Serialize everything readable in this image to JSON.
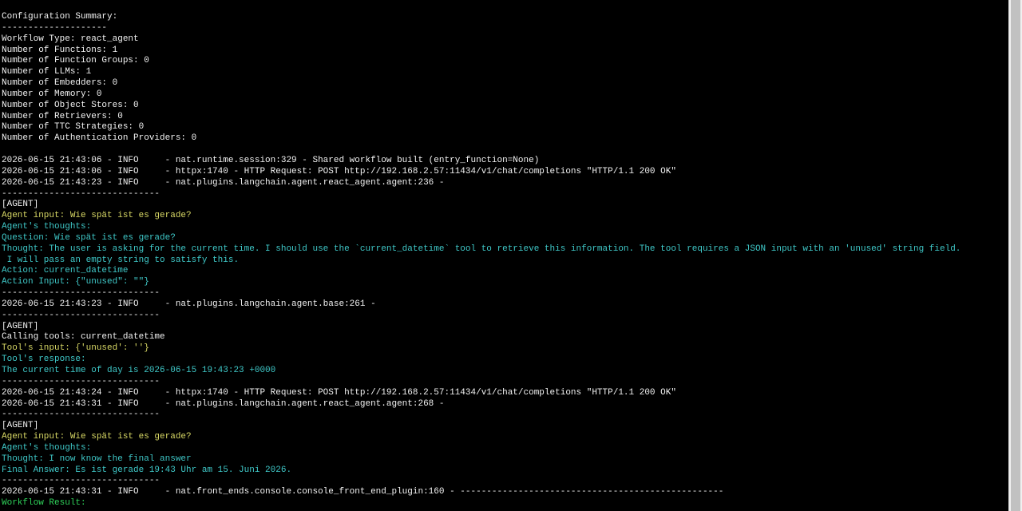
{
  "colors": {
    "background": "#000000",
    "text": "#f2f2f2",
    "agent_input": "#d7d765",
    "agent_thoughts": "#3fc8c8",
    "workflow_result": "#2fd25a",
    "scrollbar": "#f0f0f0"
  },
  "lines": [
    {
      "text": "Configuration Summary:",
      "color": "white"
    },
    {
      "text": "--------------------",
      "color": "white"
    },
    {
      "text": "Workflow Type: react_agent",
      "color": "white"
    },
    {
      "text": "Number of Functions: 1",
      "color": "white"
    },
    {
      "text": "Number of Function Groups: 0",
      "color": "white"
    },
    {
      "text": "Number of LLMs: 1",
      "color": "white"
    },
    {
      "text": "Number of Embedders: 0",
      "color": "white"
    },
    {
      "text": "Number of Memory: 0",
      "color": "white"
    },
    {
      "text": "Number of Object Stores: 0",
      "color": "white"
    },
    {
      "text": "Number of Retrievers: 0",
      "color": "white"
    },
    {
      "text": "Number of TTC Strategies: 0",
      "color": "white"
    },
    {
      "text": "Number of Authentication Providers: 0",
      "color": "white"
    },
    {
      "text": "",
      "color": "white"
    },
    {
      "text": "2026-06-15 21:43:06 - INFO     - nat.runtime.session:329 - Shared workflow built (entry_function=None)",
      "color": "white"
    },
    {
      "text": "2026-06-15 21:43:06 - INFO     - httpx:1740 - HTTP Request: POST http://192.168.2.57:11434/v1/chat/completions \"HTTP/1.1 200 OK\"",
      "color": "white"
    },
    {
      "text": "2026-06-15 21:43:23 - INFO     - nat.plugins.langchain.agent.react_agent.agent:236 -",
      "color": "white"
    },
    {
      "text": "------------------------------",
      "color": "white"
    },
    {
      "text": "[AGENT]",
      "color": "white"
    },
    {
      "text": "Agent input: Wie spät ist es gerade?",
      "color": "yellow"
    },
    {
      "text": "Agent's thoughts:",
      "color": "cyan"
    },
    {
      "text": "Question: Wie spät ist es gerade?",
      "color": "cyan"
    },
    {
      "text": "Thought: The user is asking for the current time. I should use the `current_datetime` tool to retrieve this information. The tool requires a JSON input with an 'unused' string field.",
      "color": "cyan"
    },
    {
      "text": " I will pass an empty string to satisfy this.",
      "color": "cyan"
    },
    {
      "text": "Action: current_datetime",
      "color": "cyan"
    },
    {
      "text": "Action Input: {\"unused\": \"\"}",
      "color": "cyan"
    },
    {
      "text": "------------------------------",
      "color": "white"
    },
    {
      "text": "2026-06-15 21:43:23 - INFO     - nat.plugins.langchain.agent.base:261 -",
      "color": "white"
    },
    {
      "text": "------------------------------",
      "color": "white"
    },
    {
      "text": "[AGENT]",
      "color": "white"
    },
    {
      "text": "Calling tools: current_datetime",
      "color": "white"
    },
    {
      "text": "Tool's input: {'unused': ''}",
      "color": "yellow"
    },
    {
      "text": "Tool's response:",
      "color": "cyan"
    },
    {
      "text": "The current time of day is 2026-06-15 19:43:23 +0000",
      "color": "cyan"
    },
    {
      "text": "------------------------------",
      "color": "white"
    },
    {
      "text": "2026-06-15 21:43:24 - INFO     - httpx:1740 - HTTP Request: POST http://192.168.2.57:11434/v1/chat/completions \"HTTP/1.1 200 OK\"",
      "color": "white"
    },
    {
      "text": "2026-06-15 21:43:31 - INFO     - nat.plugins.langchain.agent.react_agent.agent:268 -",
      "color": "white"
    },
    {
      "text": "------------------------------",
      "color": "white"
    },
    {
      "text": "[AGENT]",
      "color": "white"
    },
    {
      "text": "Agent input: Wie spät ist es gerade?",
      "color": "yellow"
    },
    {
      "text": "Agent's thoughts:",
      "color": "cyan"
    },
    {
      "text": "Thought: I now know the final answer",
      "color": "cyan"
    },
    {
      "text": "Final Answer: Es ist gerade 19:43 Uhr am 15. Juni 2026.",
      "color": "cyan"
    },
    {
      "text": "------------------------------",
      "color": "white"
    },
    {
      "text": "2026-06-15 21:43:31 - INFO     - nat.front_ends.console.console_front_end_plugin:160 - --------------------------------------------------",
      "color": "white"
    },
    {
      "text": "Workflow Result:",
      "color": "green"
    }
  ]
}
